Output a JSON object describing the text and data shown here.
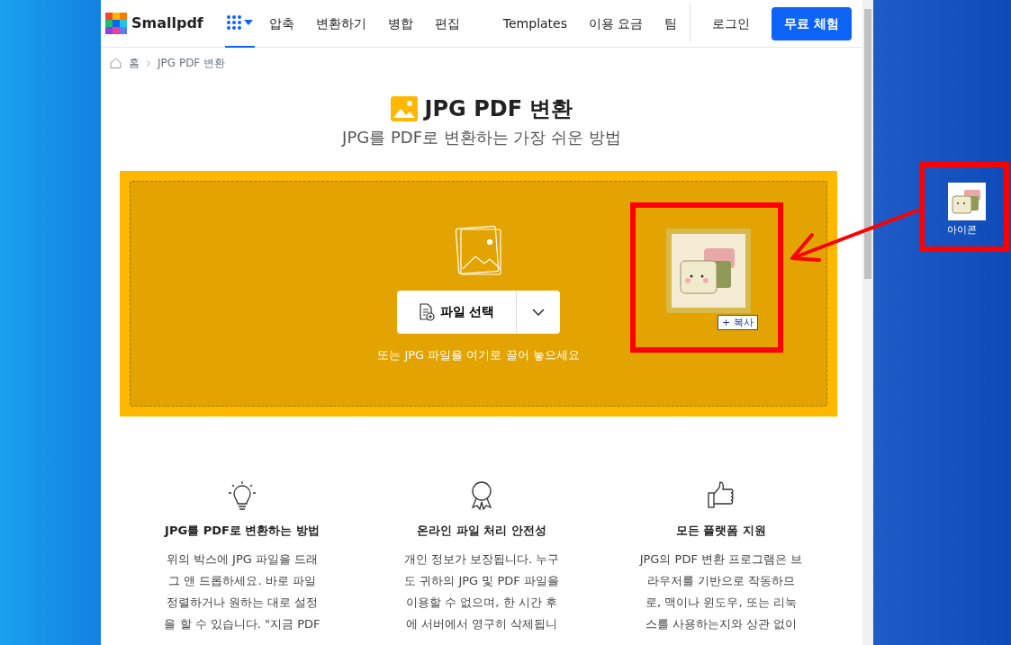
{
  "nav": {
    "logo": "Smallpdf",
    "menu": [
      {
        "label": "압축"
      },
      {
        "label": "변환하기"
      },
      {
        "label": "병합"
      },
      {
        "label": "편집"
      }
    ],
    "links": [
      {
        "label": "Templates"
      },
      {
        "label": "이용 요금"
      },
      {
        "label": "팀"
      }
    ],
    "login": "로그인",
    "trial": "무료 체험"
  },
  "breadcrumb": [
    "홈",
    "JPG PDF 변환"
  ],
  "hero": {
    "title": "JPG PDF 변환",
    "subtitle": "JPG를 PDF로 변환하는 가장 쉬운 방법"
  },
  "dropzone": {
    "button": "파일 선택",
    "hint": "또는 JPG 파일을 여기로 끌어 놓으세요",
    "drag_badge": "+ 복사"
  },
  "features": [
    {
      "kind": "bulb",
      "title": "JPG를 PDF로 변환하는 방법",
      "lines": [
        "위의 박스에 JPG 파일을 드래",
        "그 앤 드롭하세요. 바로 파일",
        "정렬하거나 원하는 대로 설정",
        "을 할 수 있습니다. \"지금 PDF"
      ]
    },
    {
      "kind": "award",
      "title": "온라인 파일 처리 안전성",
      "lines": [
        "개인 정보가 보장됩니다. 누구",
        "도 귀하의 JPG 및 PDF 파일을",
        "이용할 수 없으며, 한 시간 후",
        "에 서버에서 영구히 삭제됩니"
      ]
    },
    {
      "kind": "thumb",
      "title": "모든 플랫폼 지원",
      "lines": [
        "JPG의 PDF 변환 프로그램은 브",
        "라우저를 기반으로 작동하므",
        "로, 맥이나 윈도우, 또는 리눅",
        "스를 사용하는지와 상관 없이"
      ]
    }
  ],
  "desktop_icon": {
    "label": "아이콘"
  }
}
